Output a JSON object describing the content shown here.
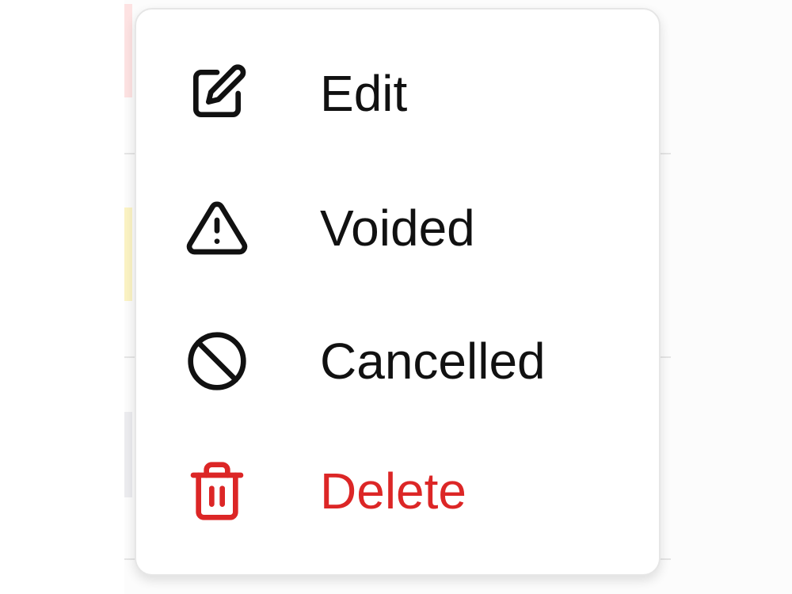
{
  "menu": {
    "items": [
      {
        "label": "Edit",
        "icon": "edit-icon"
      },
      {
        "label": "Voided",
        "icon": "warning-icon"
      },
      {
        "label": "Cancelled",
        "icon": "ban-icon"
      },
      {
        "label": "Delete",
        "icon": "trash-icon"
      }
    ]
  },
  "colors": {
    "danger": "#dc2626",
    "text": "#111111"
  }
}
